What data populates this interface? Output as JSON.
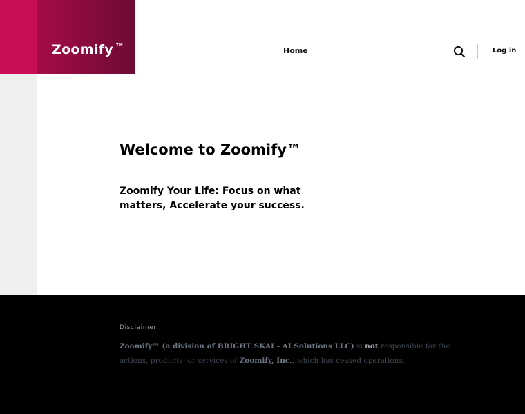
{
  "header": {
    "logo_text": "Zoomify",
    "logo_tm": "™",
    "nav": {
      "home": "Home",
      "search_icon": "search-icon",
      "login": "Log in"
    }
  },
  "main": {
    "title": "Welcome to Zoomify™",
    "tagline": "Zoomify Your Life: Focus on what matters, Accelerate your success."
  },
  "footer": {
    "heading": "Disclaimer",
    "text_parts": {
      "company": "Zoomify™ (a division of BRIGHT SKAI - AI Solutions LLC)",
      "is": " is ",
      "not": "not",
      "middle": " responsible for the actions, products, or services of ",
      "inc": "Zoomify, Inc.",
      "end": ", which has ceased operations."
    }
  },
  "colors": {
    "brand_primary": "#c80f55",
    "brand_dark": "#6e0a35",
    "footer_bg": "#000000"
  }
}
